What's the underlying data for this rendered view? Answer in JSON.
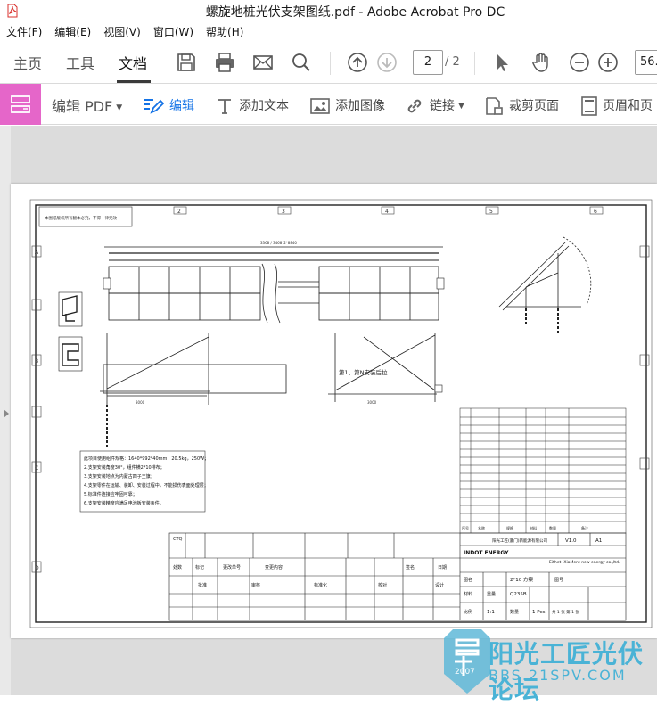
{
  "window": {
    "title": "螺旋地桩光伏支架图纸.pdf - Adobe Acrobat Pro DC",
    "app_icon": "acrobat-pdf-icon"
  },
  "menu": {
    "items": [
      "文件(F)",
      "编辑(E)",
      "视图(V)",
      "窗口(W)",
      "帮助(H)"
    ]
  },
  "toolbar": {
    "tabs": [
      "主页",
      "工具",
      "文档"
    ],
    "active_tab": "文档",
    "current_page": "2",
    "total_pages": "/ 2",
    "zoom": "56."
  },
  "editbar": {
    "edit_pdf_label": "编辑 PDF",
    "edit_label": "编辑",
    "add_text_label": "添加文本",
    "add_image_label": "添加图像",
    "link_label": "链接",
    "crop_label": "裁剪页面",
    "header_footer_label": "页眉和页"
  },
  "drawing": {
    "notes_title": "此项目使用组件规格：1640*992*40mm，20.5kg，250W；",
    "notes": [
      "2.支架安装角度30°，组件横2*10排布；",
      "3.支架安装地点为内蒙古四子王旗；",
      "4.支架零件在运输、装卸、安装过程中，不能损伤表面处理层；",
      "5.标准件连接应牢固可靠；",
      "6.支架安装精度应满足电池板安装条件。"
    ],
    "side_note": "第1、第N安装后拉",
    "top_note": "本图纸版权所有翻本必究，不得一律无效",
    "company_cn": "阳光工匠(厦门)新能源有限公司",
    "company_en": "Eithet (XiaMen) new energy co.,ltd.",
    "brand": "INDOT ENERGY",
    "drawing_name": "2*10 方案",
    "sheet": "A1",
    "version": "V1.0",
    "scale": "1:1",
    "material": "Q235B",
    "quantity": "1 Pcs",
    "sheet_of": "共 1 张 第 1 张",
    "labels": {
      "revision": "标记",
      "count": "处数",
      "change_no": "更改单号",
      "modified_by": "变更内容",
      "sign": "签名",
      "date": "日期",
      "drawn": "设计",
      "checked": "审核",
      "proofread": "校对",
      "standard": "标准化",
      "approved": "批准",
      "material_label": "材料",
      "weight": "重量",
      "scale_label": "比例",
      "qty_label": "数量",
      "name_label": "图名",
      "drawing_no": "图号",
      "ctq": "CTQ"
    },
    "bom_headers": [
      "序号",
      "名称",
      "规格",
      "材料",
      "数量",
      "备注"
    ]
  },
  "watermark": {
    "forum": "阳光工匠光伏论坛",
    "url": "BBS.21SPV.COM",
    "year": "2007"
  }
}
